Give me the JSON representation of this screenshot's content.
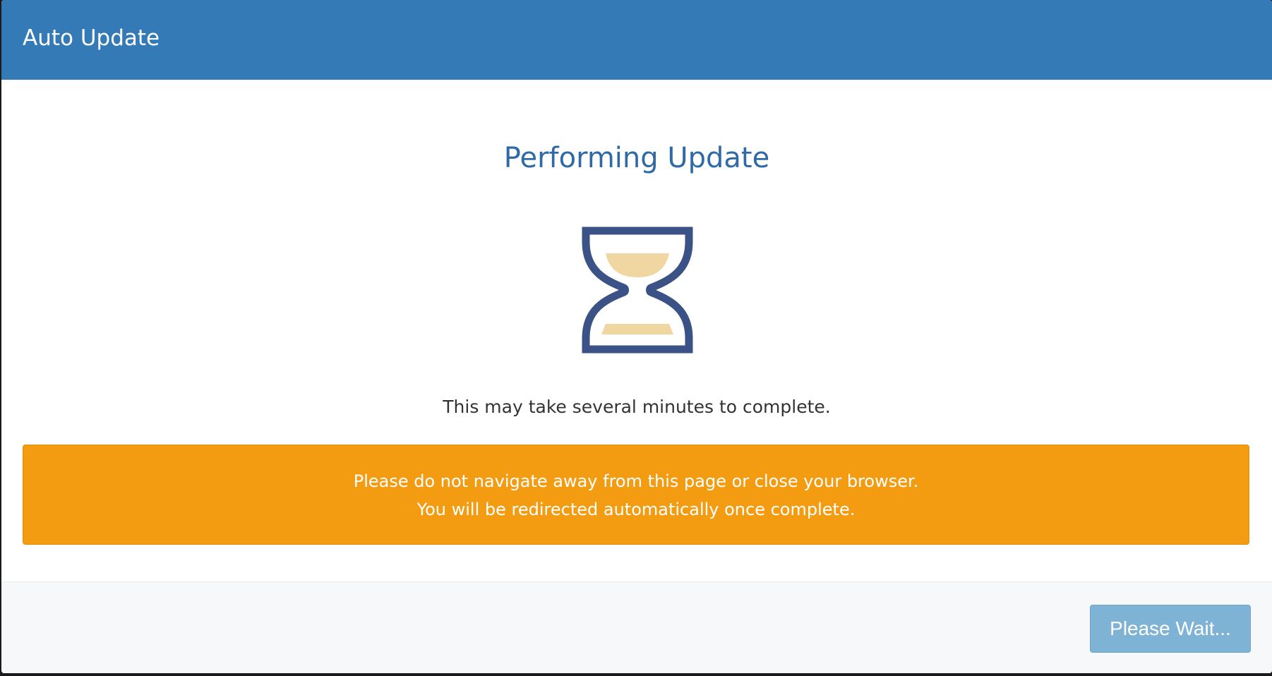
{
  "header": {
    "title": "Auto Update"
  },
  "body": {
    "heading": "Performing Update",
    "icon": "hourglass-icon",
    "note": "This may take several minutes to complete.",
    "warning": {
      "line1": "Please do not navigate away from this page or close your browser.",
      "line2": "You will be redirected automatically once complete."
    }
  },
  "footer": {
    "button_label": "Please Wait..."
  },
  "colors": {
    "header": "#337ab7",
    "heading": "#2f6aa6",
    "hourglass_frame": "#3a5285",
    "sand": "#f0d7a1",
    "warning": "#f39c12",
    "button": "#7fb3d6"
  }
}
